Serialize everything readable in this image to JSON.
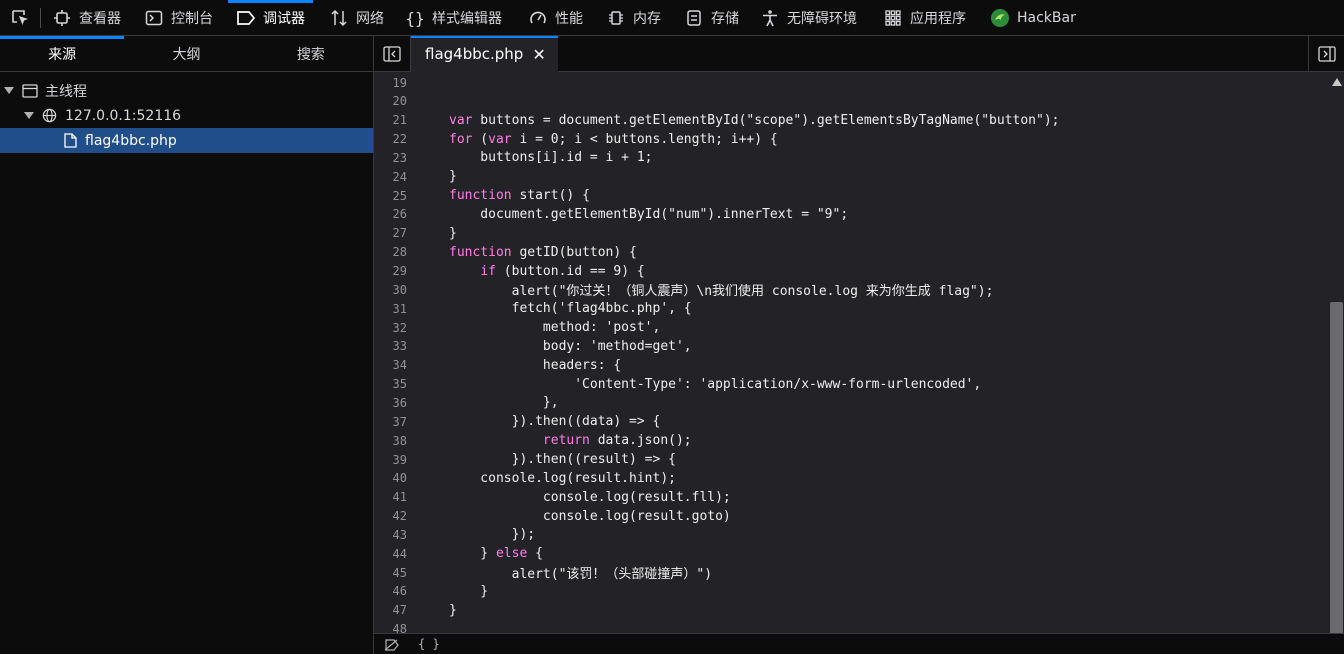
{
  "toolbar": {
    "tabs": [
      {
        "label": "查看器",
        "icon": "inspector-icon"
      },
      {
        "label": "控制台",
        "icon": "console-icon"
      },
      {
        "label": "调试器",
        "icon": "debugger-icon",
        "active": true
      },
      {
        "label": "网络",
        "icon": "network-icon"
      },
      {
        "label": "样式编辑器",
        "icon": "style-editor-icon"
      },
      {
        "label": "性能",
        "icon": "performance-icon"
      },
      {
        "label": "内存",
        "icon": "memory-icon"
      },
      {
        "label": "存储",
        "icon": "storage-icon"
      },
      {
        "label": "无障碍环境",
        "icon": "accessibility-icon"
      },
      {
        "label": "应用程序",
        "icon": "application-icon"
      },
      {
        "label": "HackBar",
        "icon": "hackbar-icon"
      }
    ]
  },
  "left_pane": {
    "tabs": [
      "来源",
      "大纲",
      "搜索"
    ],
    "tree": {
      "thread": "主线程",
      "host": "127.0.0.1:52116",
      "file": "flag4bbc.php"
    }
  },
  "editor": {
    "open_tab": "flag4bbc.php",
    "close_glyph": "✕",
    "lines": [
      {
        "n": "19",
        "t": ""
      },
      {
        "n": "20",
        "t": ""
      },
      {
        "n": "21",
        "t": "var buttons = document.getElementById(\"scope\").getElementsByTagName(\"button\");"
      },
      {
        "n": "22",
        "t": "for (var i = 0; i < buttons.length; i++) {"
      },
      {
        "n": "23",
        "t": "    buttons[i].id = i + 1;"
      },
      {
        "n": "24",
        "t": "}"
      },
      {
        "n": "25",
        "t": "function start() {"
      },
      {
        "n": "26",
        "t": "    document.getElementById(\"num\").innerText = \"9\";"
      },
      {
        "n": "27",
        "t": "}"
      },
      {
        "n": "28",
        "t": "function getID(button) {"
      },
      {
        "n": "29",
        "t": "    if (button.id == 9) {"
      },
      {
        "n": "30",
        "t": "        alert(\"你过关！（铜人震声）\\n我们使用 console.log 来为你生成 flag\");"
      },
      {
        "n": "31",
        "t": "        fetch('flag4bbc.php', {"
      },
      {
        "n": "32",
        "t": "            method: 'post',"
      },
      {
        "n": "33",
        "t": "            body: 'method=get',"
      },
      {
        "n": "34",
        "t": "            headers: {"
      },
      {
        "n": "35",
        "t": "                'Content-Type': 'application/x-www-form-urlencoded',"
      },
      {
        "n": "36",
        "t": "            },"
      },
      {
        "n": "37",
        "t": "        }).then((data) => {"
      },
      {
        "n": "38",
        "t": "            return data.json();"
      },
      {
        "n": "39",
        "t": "        }).then((result) => {"
      },
      {
        "n": "40",
        "t": "    console.log(result.hint);"
      },
      {
        "n": "41",
        "t": "            console.log(result.fll);"
      },
      {
        "n": "42",
        "t": "            console.log(result.goto)"
      },
      {
        "n": "43",
        "t": "        });"
      },
      {
        "n": "44",
        "t": "    } else {"
      },
      {
        "n": "45",
        "t": "        alert(\"该罚！（头部碰撞声）\")"
      },
      {
        "n": "46",
        "t": "    }"
      },
      {
        "n": "47",
        "t": "}"
      },
      {
        "n": "48",
        "t": ""
      }
    ]
  },
  "footer": {
    "braces": "{ }"
  }
}
